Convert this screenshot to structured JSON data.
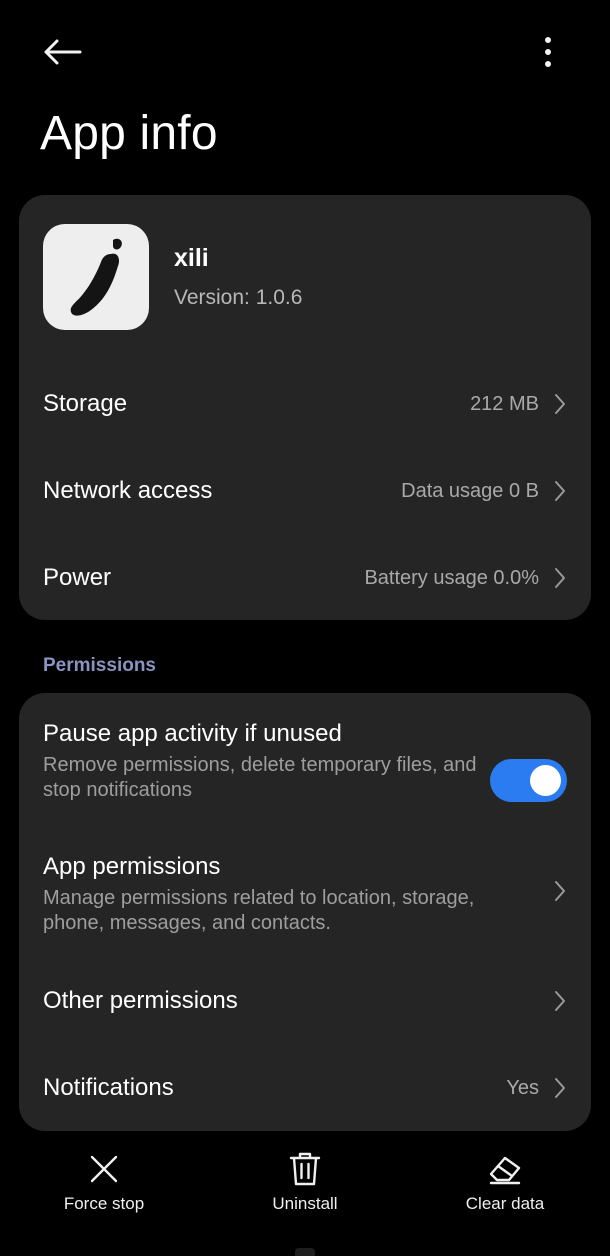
{
  "header": {
    "back_icon": "arrow-left-icon",
    "more_icon": "more-vertical-icon",
    "title": "App info"
  },
  "app": {
    "icon": "chili-pepper-icon",
    "name": "xili",
    "version": "Version: 1.0.6"
  },
  "info_rows": [
    {
      "title": "Storage",
      "value": "212 MB"
    },
    {
      "title": "Network access",
      "value": "Data usage 0 B"
    },
    {
      "title": "Power",
      "value": "Battery usage 0.0%"
    }
  ],
  "permissions": {
    "section_label": "Permissions",
    "pause_activity": {
      "title": "Pause app activity if unused",
      "subtitle": "Remove permissions, delete temporary files, and stop notifications",
      "enabled": true
    },
    "app_permissions": {
      "title": "App permissions",
      "subtitle": "Manage permissions related to location, storage, phone, messages, and contacts."
    },
    "other_permissions": {
      "title": "Other permissions"
    },
    "notifications": {
      "title": "Notifications",
      "value": "Yes"
    }
  },
  "actions": [
    {
      "label": "Force stop",
      "icon": "close-x-icon"
    },
    {
      "label": "Uninstall",
      "icon": "trash-icon"
    },
    {
      "label": "Clear data",
      "icon": "eraser-icon"
    }
  ],
  "colors": {
    "background": "#000000",
    "card": "#252525",
    "accent": "#2b7cf0",
    "section_label": "#8a93c2"
  }
}
